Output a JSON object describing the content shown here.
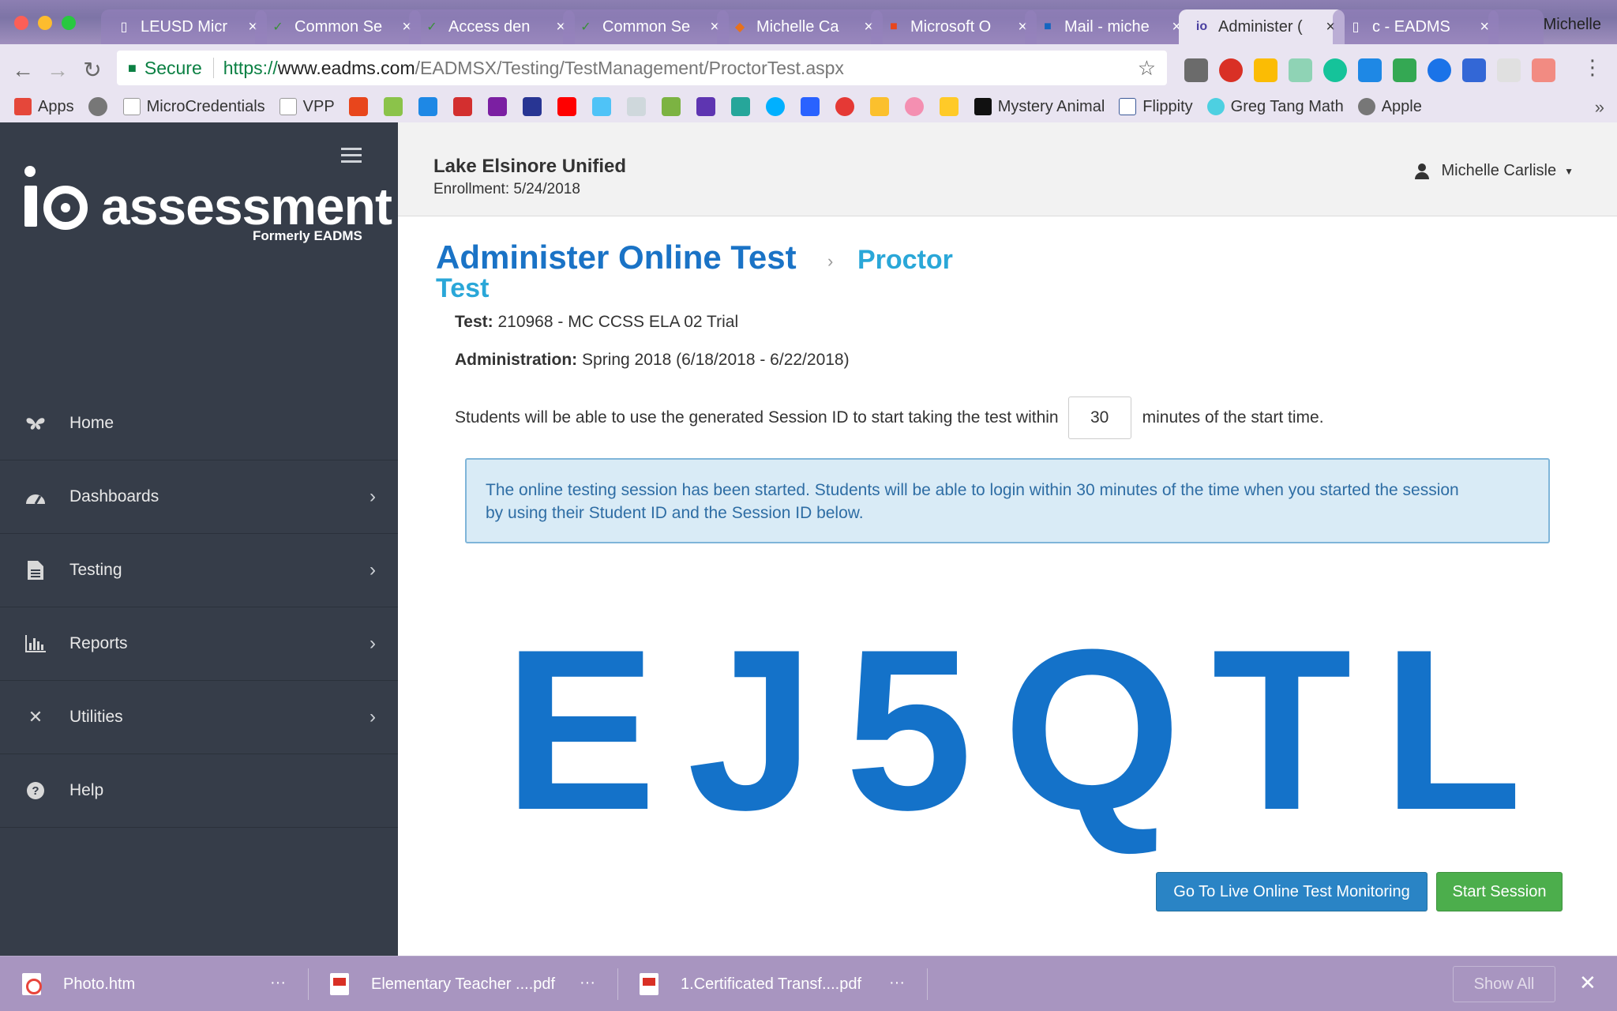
{
  "browser": {
    "profile_name": "Michelle",
    "tabs": [
      {
        "title": "LEUSD Micr",
        "favicon": "page-icon",
        "active": false
      },
      {
        "title": "Common Se",
        "favicon": "checkmark-icon",
        "active": false
      },
      {
        "title": "Access den",
        "favicon": "checkmark-icon",
        "active": false
      },
      {
        "title": "Common Se",
        "favicon": "checkmark-icon",
        "active": false
      },
      {
        "title": "Michelle Ca",
        "favicon": "shield-icon",
        "active": false
      },
      {
        "title": "Microsoft O",
        "favicon": "office-icon",
        "active": false
      },
      {
        "title": "Mail - miche",
        "favicon": "outlook-icon",
        "active": false
      },
      {
        "title": "Administer (",
        "favicon": "io-icon",
        "active": true
      },
      {
        "title": "c - EADMS",
        "favicon": "page-icon",
        "active": false
      }
    ],
    "address": {
      "secure_label": "Secure",
      "url_protocol": "https://",
      "url_host": "www.eadms.com",
      "url_path": "/EADMSX/Testing/TestManagement/ProctorTest.aspx"
    },
    "bookmarks": {
      "apps": "Apps",
      "microcredentials": "MicroCredentials",
      "vpp": "VPP",
      "mystery_animal": "Mystery Animal",
      "flippity": "Flippity",
      "greg_tang": "Greg Tang Math",
      "apple": "Apple"
    }
  },
  "sidebar": {
    "logo_text": "assessment",
    "logo_sub": "Formerly EADMS",
    "items": [
      {
        "label": "Home",
        "icon": "butterfly-icon",
        "has_chevron": false
      },
      {
        "label": "Dashboards",
        "icon": "dashboard-icon",
        "has_chevron": true
      },
      {
        "label": "Testing",
        "icon": "document-icon",
        "has_chevron": true
      },
      {
        "label": "Reports",
        "icon": "bar-chart-icon",
        "has_chevron": true
      },
      {
        "label": "Utilities",
        "icon": "tools-icon",
        "has_chevron": true
      },
      {
        "label": "Help",
        "icon": "question-icon",
        "has_chevron": false
      }
    ]
  },
  "header": {
    "district": "Lake Elsinore Unified",
    "enrollment": "Enrollment: 5/24/2018",
    "user": "Michelle Carlisle"
  },
  "main": {
    "title": "Administer Online Test",
    "crumb_current_line1": "Proctor",
    "crumb_current_line2": "Test",
    "test_label": "Test:",
    "test_value": "210968 - MC CCSS ELA 02 Trial",
    "admin_label": "Administration:",
    "admin_value": "Spring 2018 (6/18/2018 - 6/22/2018)",
    "minutes_prefix": "Students will be able to use the generated Session ID to start taking the test within",
    "minutes_value": "30",
    "minutes_suffix": "minutes of the start time.",
    "alert_line1": "The online testing session has been started. Students will be able to login within 30 minutes of the time when you started the session",
    "alert_line2": "by using their Student ID and the Session ID below.",
    "session_id": [
      "E",
      "J",
      "5",
      "Q",
      "T",
      "L"
    ],
    "monitor_button": "Go To Live Online Test Monitoring",
    "start_button": "Start Session"
  },
  "downloads": {
    "items": [
      "Photo.htm",
      "Elementary Teacher ....pdf",
      "1.Certificated Transf....pdf"
    ],
    "more": "···",
    "show_all": "Show All"
  },
  "colors": {
    "brand_blue": "#1472c9",
    "crumb_cyan": "#2aa7d8",
    "sidebar_bg": "#363d49",
    "start_green": "#4cae4c",
    "monitor_blue": "#2a84c5"
  }
}
